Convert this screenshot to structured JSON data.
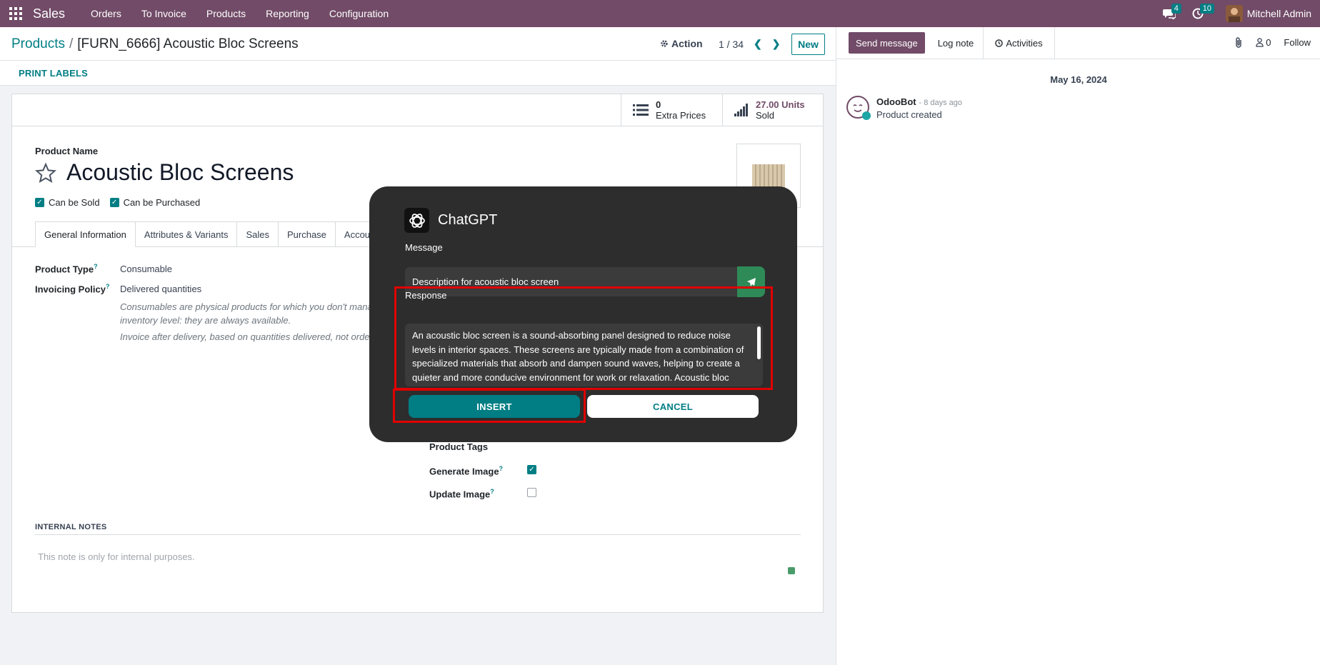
{
  "navbar": {
    "app_name": "Sales",
    "menu": [
      "Orders",
      "To Invoice",
      "Products",
      "Reporting",
      "Configuration"
    ],
    "messages_badge": "4",
    "activities_badge": "10",
    "user_name": "Mitchell Admin"
  },
  "control": {
    "breadcrumb_parent": "Products",
    "breadcrumb_current": "[FURN_6666] Acoustic Bloc Screens",
    "action_label": "Action",
    "pager": "1 / 34",
    "new_label": "New",
    "print_labels": "PRINT LABELS"
  },
  "stats": {
    "extra_prices_value": "0",
    "extra_prices_label": "Extra Prices",
    "sold_value": "27.00 Units",
    "sold_label": "Sold"
  },
  "product": {
    "name_label": "Product Name",
    "name": "Acoustic Bloc Screens",
    "can_be_sold": "Can be Sold",
    "can_be_purchased": "Can be Purchased"
  },
  "tabs": [
    "General Information",
    "Attributes & Variants",
    "Sales",
    "Purchase",
    "Accou"
  ],
  "fields": {
    "product_type_label": "Product Type",
    "product_type_value": "Consumable",
    "invoicing_policy_label": "Invoicing Policy",
    "invoicing_policy_value": "Delivered quantities",
    "help_consumable_1": "Consumables are physical products for which you don't mana",
    "help_consumable_2": "inventory level: they are always available.",
    "help_invoice": "Invoice after delivery, based on quantities delivered, not order",
    "product_tags_label": "Product Tags",
    "generate_image_label": "Generate Image",
    "update_image_label": "Update Image"
  },
  "notes": {
    "title": "INTERNAL NOTES",
    "placeholder": "This note is only for internal purposes."
  },
  "chatter": {
    "send_message": "Send message",
    "log_note": "Log note",
    "activities": "Activities",
    "followers_count": "0",
    "follow": "Follow",
    "date": "May 16, 2024",
    "author": "OdooBot",
    "time": "- 8 days ago",
    "body": "Product created"
  },
  "modal": {
    "title": "ChatGPT",
    "message_label": "Message",
    "message_value": "Description for acoustic bloc screen",
    "response_label": "Response",
    "response_text": "An acoustic bloc screen is a sound-absorbing panel designed to reduce noise levels in interior spaces. These screens are typically made from a combination of specialized materials that absorb and dampen sound waves, helping to create a quieter and more conducive environment for work or relaxation. Acoustic bloc screens are commonly used in offices, schools, and other spaces where noise control is important.",
    "insert_label": "INSERT",
    "cancel_label": "CANCEL"
  },
  "colors": {
    "brand": "#714b67",
    "accent": "#017e84",
    "highlight": "#e00000"
  }
}
